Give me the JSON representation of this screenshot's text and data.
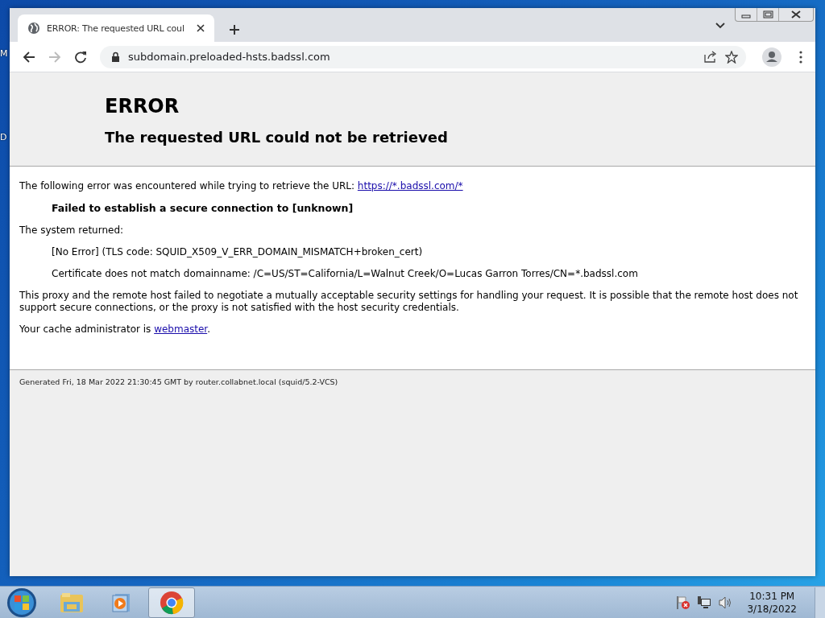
{
  "desktop_labels": [
    "M",
    "D"
  ],
  "browser": {
    "tabs": [
      {
        "title": "ERROR: The requested URL coul",
        "selected": true
      }
    ],
    "address": "subdomain.preloaded-hsts.badssl.com"
  },
  "page": {
    "title": "ERROR",
    "subtitle": "The requested URL could not be retrieved",
    "intro": "The following error was encountered while trying to retrieve the URL: ",
    "intro_link": "https://*.badssl.com/*",
    "error": "Failed to establish a secure connection to [unknown]",
    "system_label": "The system returned:",
    "details": [
      "[No Error] (TLS code: SQUID_X509_V_ERR_DOMAIN_MISMATCH+broken_cert)",
      "Certificate does not match domainname: /C=US/ST=California/L=Walnut Creek/O=Lucas Garron Torres/CN=*.badssl.com"
    ],
    "explanation": "This proxy and the remote host failed to negotiate a mutually acceptable security settings for handling your request. It is possible that the remote host does not support secure connections, or the proxy is not satisfied with the host security credentials.",
    "admin_text": "Your cache administrator is ",
    "admin_link": "webmaster",
    "admin_end": ".",
    "footer": "Generated Fri, 18 Mar 2022 21:30:45 GMT by router.collabnet.local (squid/5.2-VCS)"
  },
  "taskbar": {
    "apps": [
      {
        "kind": "explorer",
        "selected": false
      },
      {
        "kind": "media",
        "selected": false
      },
      {
        "kind": "chrome",
        "selected": true
      }
    ],
    "time": "10:31 PM",
    "date": "3/18/2022"
  }
}
